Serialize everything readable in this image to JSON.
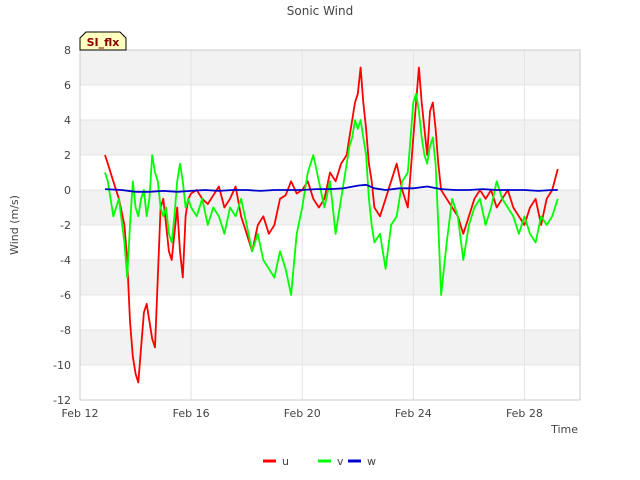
{
  "chart_data": {
    "type": "line",
    "title": "Sonic Wind",
    "xlabel": "Time",
    "ylabel": "Wind (m/s)",
    "badge": "SI_flx",
    "ylim": [
      -12,
      8
    ],
    "yticks": [
      -12,
      -10,
      -8,
      -6,
      -4,
      -2,
      0,
      2,
      4,
      6,
      8
    ],
    "xlim": [
      12,
      30
    ],
    "xticks": [
      {
        "value": 12,
        "label": "Feb 12"
      },
      {
        "value": 16,
        "label": "Feb 16"
      },
      {
        "value": 20,
        "label": "Feb 20"
      },
      {
        "value": 24,
        "label": "Feb 24"
      },
      {
        "value": 28,
        "label": "Feb 28"
      }
    ],
    "legend_position": "bottom-center",
    "grid": true,
    "series": [
      {
        "name": "u",
        "color": "#ff0000",
        "x": [
          12.9,
          13.0,
          13.2,
          13.4,
          13.6,
          13.7,
          13.8,
          13.9,
          14.0,
          14.1,
          14.2,
          14.3,
          14.4,
          14.5,
          14.6,
          14.7,
          14.8,
          14.9,
          15.0,
          15.1,
          15.2,
          15.3,
          15.4,
          15.5,
          15.6,
          15.7,
          15.8,
          15.9,
          16.0,
          16.2,
          16.4,
          16.6,
          16.8,
          17.0,
          17.2,
          17.4,
          17.6,
          17.8,
          18.0,
          18.2,
          18.4,
          18.6,
          18.8,
          19.0,
          19.2,
          19.4,
          19.6,
          19.8,
          20.0,
          20.2,
          20.4,
          20.6,
          20.8,
          21.0,
          21.2,
          21.4,
          21.6,
          21.7,
          21.8,
          21.9,
          22.0,
          22.1,
          22.2,
          22.3,
          22.4,
          22.5,
          22.6,
          22.8,
          23.0,
          23.2,
          23.4,
          23.6,
          23.8,
          23.9,
          24.0,
          24.1,
          24.2,
          24.3,
          24.4,
          24.5,
          24.6,
          24.7,
          24.8,
          24.9,
          25.0,
          25.2,
          25.4,
          25.6,
          25.8,
          26.0,
          26.2,
          26.4,
          26.6,
          26.8,
          27.0,
          27.2,
          27.4,
          27.6,
          27.8,
          28.0,
          28.2,
          28.4,
          28.6,
          28.8,
          29.0,
          29.2
        ],
        "y": [
          2.0,
          1.5,
          0.5,
          -0.5,
          -2.0,
          -4.0,
          -7.5,
          -9.5,
          -10.5,
          -11.0,
          -9.0,
          -7.0,
          -6.5,
          -7.5,
          -8.5,
          -9.0,
          -5.0,
          -1.0,
          -0.5,
          -2.0,
          -3.5,
          -4.0,
          -2.5,
          -1.0,
          -3.5,
          -5.0,
          -1.5,
          -0.5,
          -0.2,
          0.0,
          -0.5,
          -0.8,
          -0.3,
          0.2,
          -1.0,
          -0.5,
          0.2,
          -1.5,
          -2.5,
          -3.5,
          -2.0,
          -1.5,
          -2.5,
          -2.0,
          -0.5,
          -0.3,
          0.5,
          -0.2,
          0.0,
          0.5,
          -0.5,
          -1.0,
          -0.5,
          1.0,
          0.5,
          1.5,
          2.0,
          3.0,
          4.0,
          5.0,
          5.5,
          7.0,
          5.0,
          3.5,
          1.5,
          0.5,
          -1.0,
          -1.5,
          -0.5,
          0.5,
          1.5,
          0.0,
          -1.0,
          1.0,
          3.0,
          5.0,
          7.0,
          5.0,
          3.5,
          2.0,
          4.5,
          5.0,
          3.5,
          1.5,
          0.0,
          -0.5,
          -1.0,
          -1.5,
          -2.5,
          -1.5,
          -0.5,
          0.0,
          -0.5,
          0.0,
          -1.0,
          -0.5,
          0.0,
          -1.0,
          -1.5,
          -2.0,
          -1.0,
          -0.5,
          -2.0,
          -0.5,
          0.0,
          1.2
        ]
      },
      {
        "name": "v",
        "color": "#00ff00",
        "x": [
          12.9,
          13.0,
          13.2,
          13.4,
          13.6,
          13.7,
          13.8,
          13.9,
          14.0,
          14.1,
          14.2,
          14.3,
          14.4,
          14.5,
          14.6,
          14.7,
          14.8,
          14.9,
          15.0,
          15.1,
          15.2,
          15.3,
          15.4,
          15.5,
          15.6,
          15.7,
          15.8,
          15.9,
          16.0,
          16.2,
          16.4,
          16.6,
          16.8,
          17.0,
          17.2,
          17.4,
          17.6,
          17.8,
          18.0,
          18.2,
          18.4,
          18.6,
          18.8,
          19.0,
          19.2,
          19.4,
          19.6,
          19.8,
          20.0,
          20.2,
          20.4,
          20.6,
          20.8,
          21.0,
          21.2,
          21.4,
          21.6,
          21.7,
          21.8,
          21.9,
          22.0,
          22.1,
          22.2,
          22.3,
          22.4,
          22.5,
          22.6,
          22.8,
          23.0,
          23.2,
          23.4,
          23.6,
          23.8,
          23.9,
          24.0,
          24.1,
          24.2,
          24.3,
          24.4,
          24.5,
          24.6,
          24.7,
          24.8,
          24.9,
          25.0,
          25.2,
          25.4,
          25.6,
          25.8,
          26.0,
          26.2,
          26.4,
          26.6,
          26.8,
          27.0,
          27.2,
          27.4,
          27.6,
          27.8,
          28.0,
          28.2,
          28.4,
          28.6,
          28.8,
          29.0,
          29.2
        ],
        "y": [
          1.0,
          0.5,
          -1.5,
          -0.5,
          -3.0,
          -5.0,
          -2.0,
          0.5,
          -1.0,
          -1.5,
          -0.5,
          0.0,
          -1.5,
          -0.5,
          2.0,
          1.0,
          0.5,
          -1.0,
          -1.5,
          -1.0,
          -2.5,
          -3.0,
          -1.5,
          0.5,
          1.5,
          0.5,
          -1.0,
          -0.5,
          -1.0,
          -1.5,
          -0.5,
          -2.0,
          -1.0,
          -1.5,
          -2.5,
          -1.0,
          -1.5,
          -0.5,
          -2.0,
          -3.5,
          -2.5,
          -4.0,
          -4.5,
          -5.0,
          -3.5,
          -4.5,
          -6.0,
          -2.5,
          -1.0,
          1.0,
          2.0,
          0.5,
          -1.0,
          0.5,
          -2.5,
          -0.5,
          1.5,
          2.5,
          3.0,
          4.0,
          3.5,
          4.0,
          3.0,
          2.0,
          -0.5,
          -2.0,
          -3.0,
          -2.5,
          -4.5,
          -2.0,
          -1.5,
          0.5,
          1.0,
          3.0,
          5.0,
          5.5,
          4.5,
          3.0,
          2.0,
          1.5,
          2.5,
          3.0,
          1.5,
          -2.0,
          -6.0,
          -3.0,
          -0.5,
          -1.5,
          -4.0,
          -2.0,
          -1.0,
          -0.5,
          -2.0,
          -1.0,
          0.5,
          -0.5,
          -1.0,
          -1.5,
          -2.5,
          -1.5,
          -2.5,
          -3.0,
          -1.5,
          -2.0,
          -1.5,
          -0.5
        ]
      },
      {
        "name": "w",
        "color": "#0000cc",
        "x": [
          12.9,
          13.5,
          14.0,
          14.5,
          15.0,
          15.5,
          16.0,
          16.5,
          17.0,
          17.5,
          18.0,
          18.5,
          19.0,
          19.5,
          20.0,
          20.5,
          21.0,
          21.5,
          22.0,
          22.3,
          22.6,
          23.0,
          23.5,
          24.0,
          24.5,
          25.0,
          25.5,
          26.0,
          26.5,
          27.0,
          27.5,
          28.0,
          28.5,
          29.0,
          29.2
        ],
        "y": [
          0.05,
          0.0,
          -0.1,
          -0.1,
          -0.05,
          -0.1,
          -0.05,
          0.0,
          -0.05,
          0.0,
          0.0,
          -0.05,
          0.0,
          0.0,
          0.0,
          0.05,
          0.05,
          0.1,
          0.25,
          0.3,
          0.1,
          0.0,
          0.1,
          0.1,
          0.2,
          0.05,
          0.0,
          0.0,
          0.05,
          0.0,
          0.0,
          0.0,
          -0.05,
          0.0,
          0.0
        ]
      }
    ]
  }
}
